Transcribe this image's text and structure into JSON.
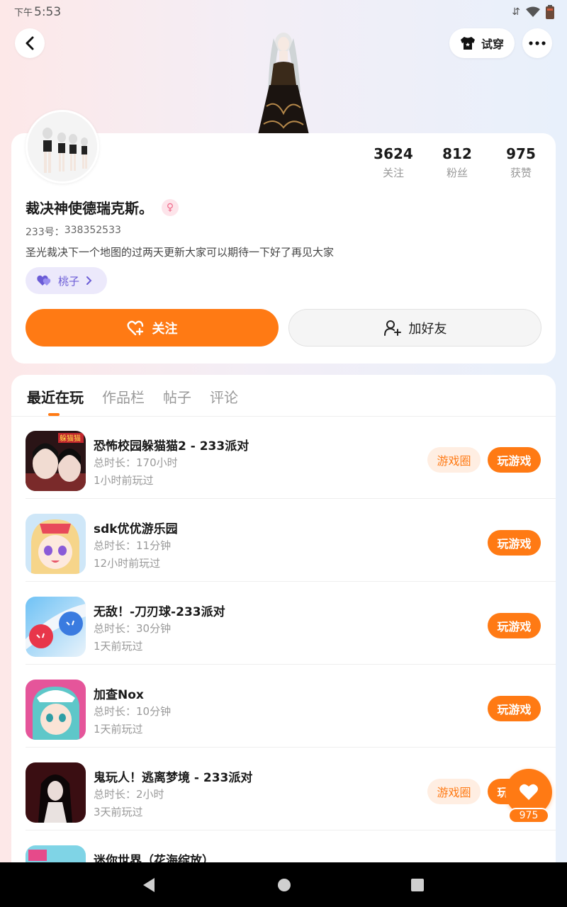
{
  "status_bar": {
    "ampm": "下午",
    "time": "5:53"
  },
  "header": {
    "tryon_label": "试穿"
  },
  "profile": {
    "stats": [
      {
        "value": "3624",
        "label": "关注"
      },
      {
        "value": "812",
        "label": "粉丝"
      },
      {
        "value": "975",
        "label": "获赞"
      }
    ],
    "nickname": "裁决神使德瑞克斯。",
    "id_label": "233号：",
    "id_value": "338352533",
    "bio": "圣光裁决下一个地图的过两天更新大家可以期待一下好了再见大家",
    "tag": "桃子",
    "follow_label": "关注",
    "add_friend_label": "加好友"
  },
  "tabs": [
    "最近在玩",
    "作品栏",
    "帖子",
    "评论"
  ],
  "games": [
    {
      "title": "恐怖校园躲猫猫2 - 233派对",
      "duration_label": "总时长：",
      "duration": "170小时",
      "last_played": "1小时前玩过",
      "circle_label": "游戏圈",
      "play_label": "玩游戏"
    },
    {
      "title": "sdk优优游乐园",
      "duration_label": "总时长：",
      "duration": "11分钟",
      "last_played": "12小时前玩过",
      "circle_label": "",
      "play_label": "玩游戏"
    },
    {
      "title": "无敌！-刀刃球-233派对",
      "duration_label": "总时长：",
      "duration": "30分钟",
      "last_played": "1天前玩过",
      "circle_label": "",
      "play_label": "玩游戏"
    },
    {
      "title": "加查Nox",
      "duration_label": "总时长：",
      "duration": "10分钟",
      "last_played": "1天前玩过",
      "circle_label": "",
      "play_label": "玩游戏"
    },
    {
      "title": "鬼玩人！逃离梦境 - 233派对",
      "duration_label": "总时长：",
      "duration": "2小时",
      "last_played": "3天前玩过",
      "circle_label": "游戏圈",
      "play_label": "玩游戏"
    },
    {
      "title": "迷你世界（花海绽放）",
      "duration_label": "",
      "duration": "",
      "last_played": "",
      "circle_label": "",
      "play_label": ""
    }
  ],
  "like_fab": {
    "count": "975"
  },
  "colors": {
    "accent": "#ff7a14",
    "accent_light": "#ffeee2",
    "tag_bg": "#ece9fb",
    "tag_fg": "#6b5cd6"
  }
}
